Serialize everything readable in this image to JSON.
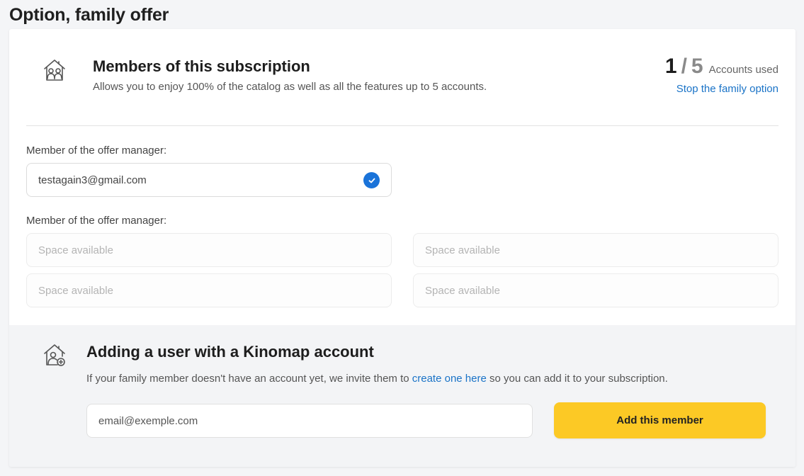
{
  "page": {
    "title": "Option, family offer"
  },
  "members": {
    "icon": "family-house-icon",
    "title": "Members of this subscription",
    "subtitle": "Allows you to enjoy 100% of the catalog as well as all the features up to 5 accounts.",
    "accounts_used": "1",
    "separator": "/",
    "accounts_total": "5",
    "accounts_label": "Accounts used",
    "stop_link": "Stop the family option"
  },
  "manager": {
    "label": "Member of the offer manager:",
    "email": "testagain3@gmail.com",
    "status_icon": "check-circle-icon"
  },
  "slots": {
    "label": "Member of the offer manager:",
    "items": [
      "Space available",
      "Space available",
      "Space available",
      "Space available"
    ]
  },
  "add_member": {
    "icon": "add-user-house-icon",
    "title": "Adding a user with a Kinomap account",
    "desc_before": "If your family member doesn't have an account yet, we invite them to ",
    "desc_link": "create one here",
    "desc_after": " so you can add it to your subscription.",
    "email_placeholder": "email@exemple.com",
    "button_label": "Add this member"
  },
  "colors": {
    "accent_blue": "#1a73d9",
    "link_blue": "#1a73c7",
    "button_yellow": "#fcc925"
  }
}
